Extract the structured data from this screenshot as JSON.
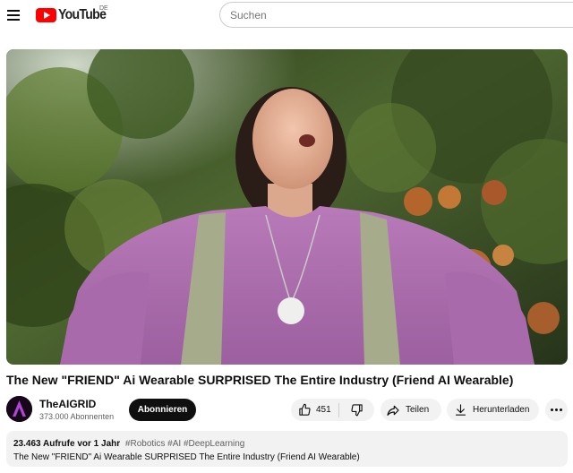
{
  "header": {
    "logo_text": "YouTube",
    "region": "DE",
    "search_placeholder": "Suchen",
    "menu_icon": "hamburger-menu-icon"
  },
  "video": {
    "title": "The New \"FRIEND\" Ai Wearable SURPRISED The Entire Industry (Friend AI Wearable)"
  },
  "channel": {
    "name": "TheAIGRID",
    "subscribers": "373.000 Abonnenten",
    "subscribe_label": "Abonnieren"
  },
  "actions": {
    "like_count": "451",
    "share_label": "Teilen",
    "download_label": "Herunterladen"
  },
  "description": {
    "views": "23.463 Aufrufe",
    "date": "vor 1 Jahr",
    "tags": "#Robotics #AI #DeepLearning",
    "text": "The New \"FRIEND\" Ai Wearable SURPRISED The Entire Industry (Friend AI Wearable)"
  },
  "colors": {
    "brand_red": "#ff0000",
    "button_dark": "#0f0f0f",
    "pill_bg": "#f2f2f2",
    "secondary_text": "#606060"
  }
}
